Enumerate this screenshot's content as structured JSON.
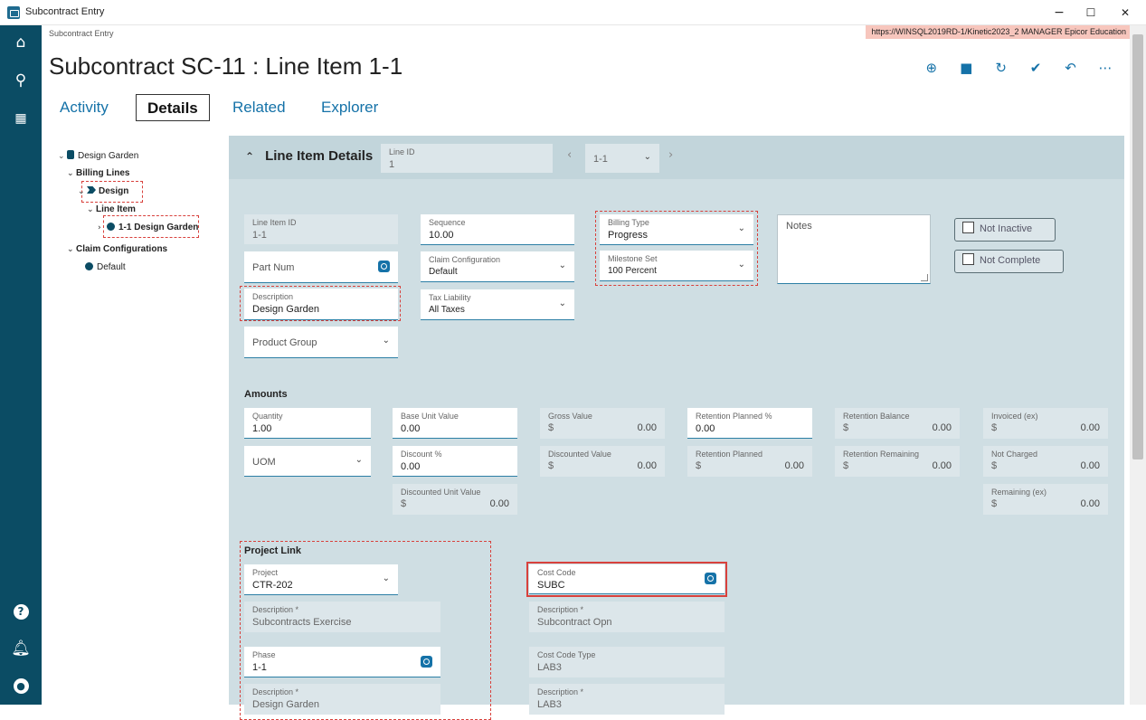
{
  "window": {
    "title": "Subcontract Entry",
    "min": "−",
    "max": "☐",
    "close": "✕"
  },
  "breadcrumb": "Subcontract Entry",
  "server_info": "https://WINSQL2019RD-1/Kinetic2023_2   MANAGER   Epicor Education",
  "page_title": "Subcontract SC-11 : Line Item 1-1",
  "tabs": [
    "Activity",
    "Details",
    "Related",
    "Explorer"
  ],
  "tree": {
    "root": "Design Garden",
    "billing_lines": "Billing Lines",
    "design": "Design",
    "line_item": "Line Item",
    "line_item_child": "1-1 Design Garden",
    "claim_configurations": "Claim Configurations",
    "default": "Default"
  },
  "header": {
    "title": "Line Item Details",
    "line_id_label": "Line ID",
    "line_id_value": "1",
    "nav_value": "1-1"
  },
  "fields": {
    "line_item_id": {
      "label": "Line Item ID",
      "value": "1-1"
    },
    "part_num": {
      "placeholder": "Part Num"
    },
    "description": {
      "label": "Description",
      "value": "Design Garden"
    },
    "product_group": {
      "placeholder": "Product Group"
    },
    "sequence": {
      "label": "Sequence",
      "value": "10.00"
    },
    "claim_configuration": {
      "label": "Claim Configuration",
      "value": "Default"
    },
    "tax_liability": {
      "label": "Tax Liability",
      "value": "All Taxes"
    },
    "billing_type": {
      "label": "Billing Type",
      "value": "Progress"
    },
    "milestone_set": {
      "label": "Milestone Set",
      "value": "100 Percent"
    },
    "notes": {
      "placeholder": "Notes"
    },
    "not_inactive": "Not Inactive",
    "not_complete": "Not Complete"
  },
  "amounts": {
    "title": "Amounts",
    "quantity": {
      "label": "Quantity",
      "value": "1.00"
    },
    "uom": {
      "placeholder": "UOM"
    },
    "base_unit_value": {
      "label": "Base Unit Value",
      "value": "0.00"
    },
    "discount_pct": {
      "label": "Discount %",
      "value": "0.00"
    },
    "discounted_unit_value": {
      "label": "Discounted Unit Value",
      "currency": "$",
      "value": "0.00"
    },
    "gross_value": {
      "label": "Gross Value",
      "currency": "$",
      "value": "0.00"
    },
    "discounted_value": {
      "label": "Discounted Value",
      "currency": "$",
      "value": "0.00"
    },
    "retention_planned_pct": {
      "label": "Retention Planned %",
      "value": "0.00"
    },
    "retention_planned": {
      "label": "Retention Planned",
      "currency": "$",
      "value": "0.00"
    },
    "retention_balance": {
      "label": "Retention Balance",
      "currency": "$",
      "value": "0.00"
    },
    "retention_remaining": {
      "label": "Retention Remaining",
      "currency": "$",
      "value": "0.00"
    },
    "invoiced_ex": {
      "label": "Invoiced (ex)",
      "currency": "$",
      "value": "0.00"
    },
    "not_charged": {
      "label": "Not Charged",
      "currency": "$",
      "value": "0.00"
    },
    "remaining_ex": {
      "label": "Remaining (ex)",
      "currency": "$",
      "value": "0.00"
    }
  },
  "project_link": {
    "title": "Project Link",
    "project": {
      "label": "Project",
      "value": "CTR-202"
    },
    "project_description": {
      "label": "Description *",
      "value": "Subcontracts Exercise"
    },
    "phase": {
      "label": "Phase",
      "value": "1-1"
    },
    "phase_description": {
      "label": "Description *",
      "value": "Design Garden"
    },
    "cost_code": {
      "label": "Cost Code",
      "value": "SUBC"
    },
    "cost_code_description": {
      "label": "Description *",
      "value": "Subcontract Opn"
    },
    "cost_code_type": {
      "label": "Cost Code Type",
      "value": "LAB3"
    },
    "cost_code_type_description": {
      "label": "Description *",
      "value": "LAB3"
    }
  },
  "colors": {
    "nav": "#0b4c64",
    "accent": "#1572a8",
    "panel": "#cfdee3",
    "highlight": "#d8413c",
    "server_badge": "#f7c6bd"
  },
  "icons": [
    "home-icon",
    "search-icon",
    "grid-icon",
    "help-icon",
    "bell-icon",
    "user-icon",
    "add-icon",
    "save-icon",
    "refresh-icon",
    "clear-icon",
    "undo-icon",
    "more-icon"
  ]
}
